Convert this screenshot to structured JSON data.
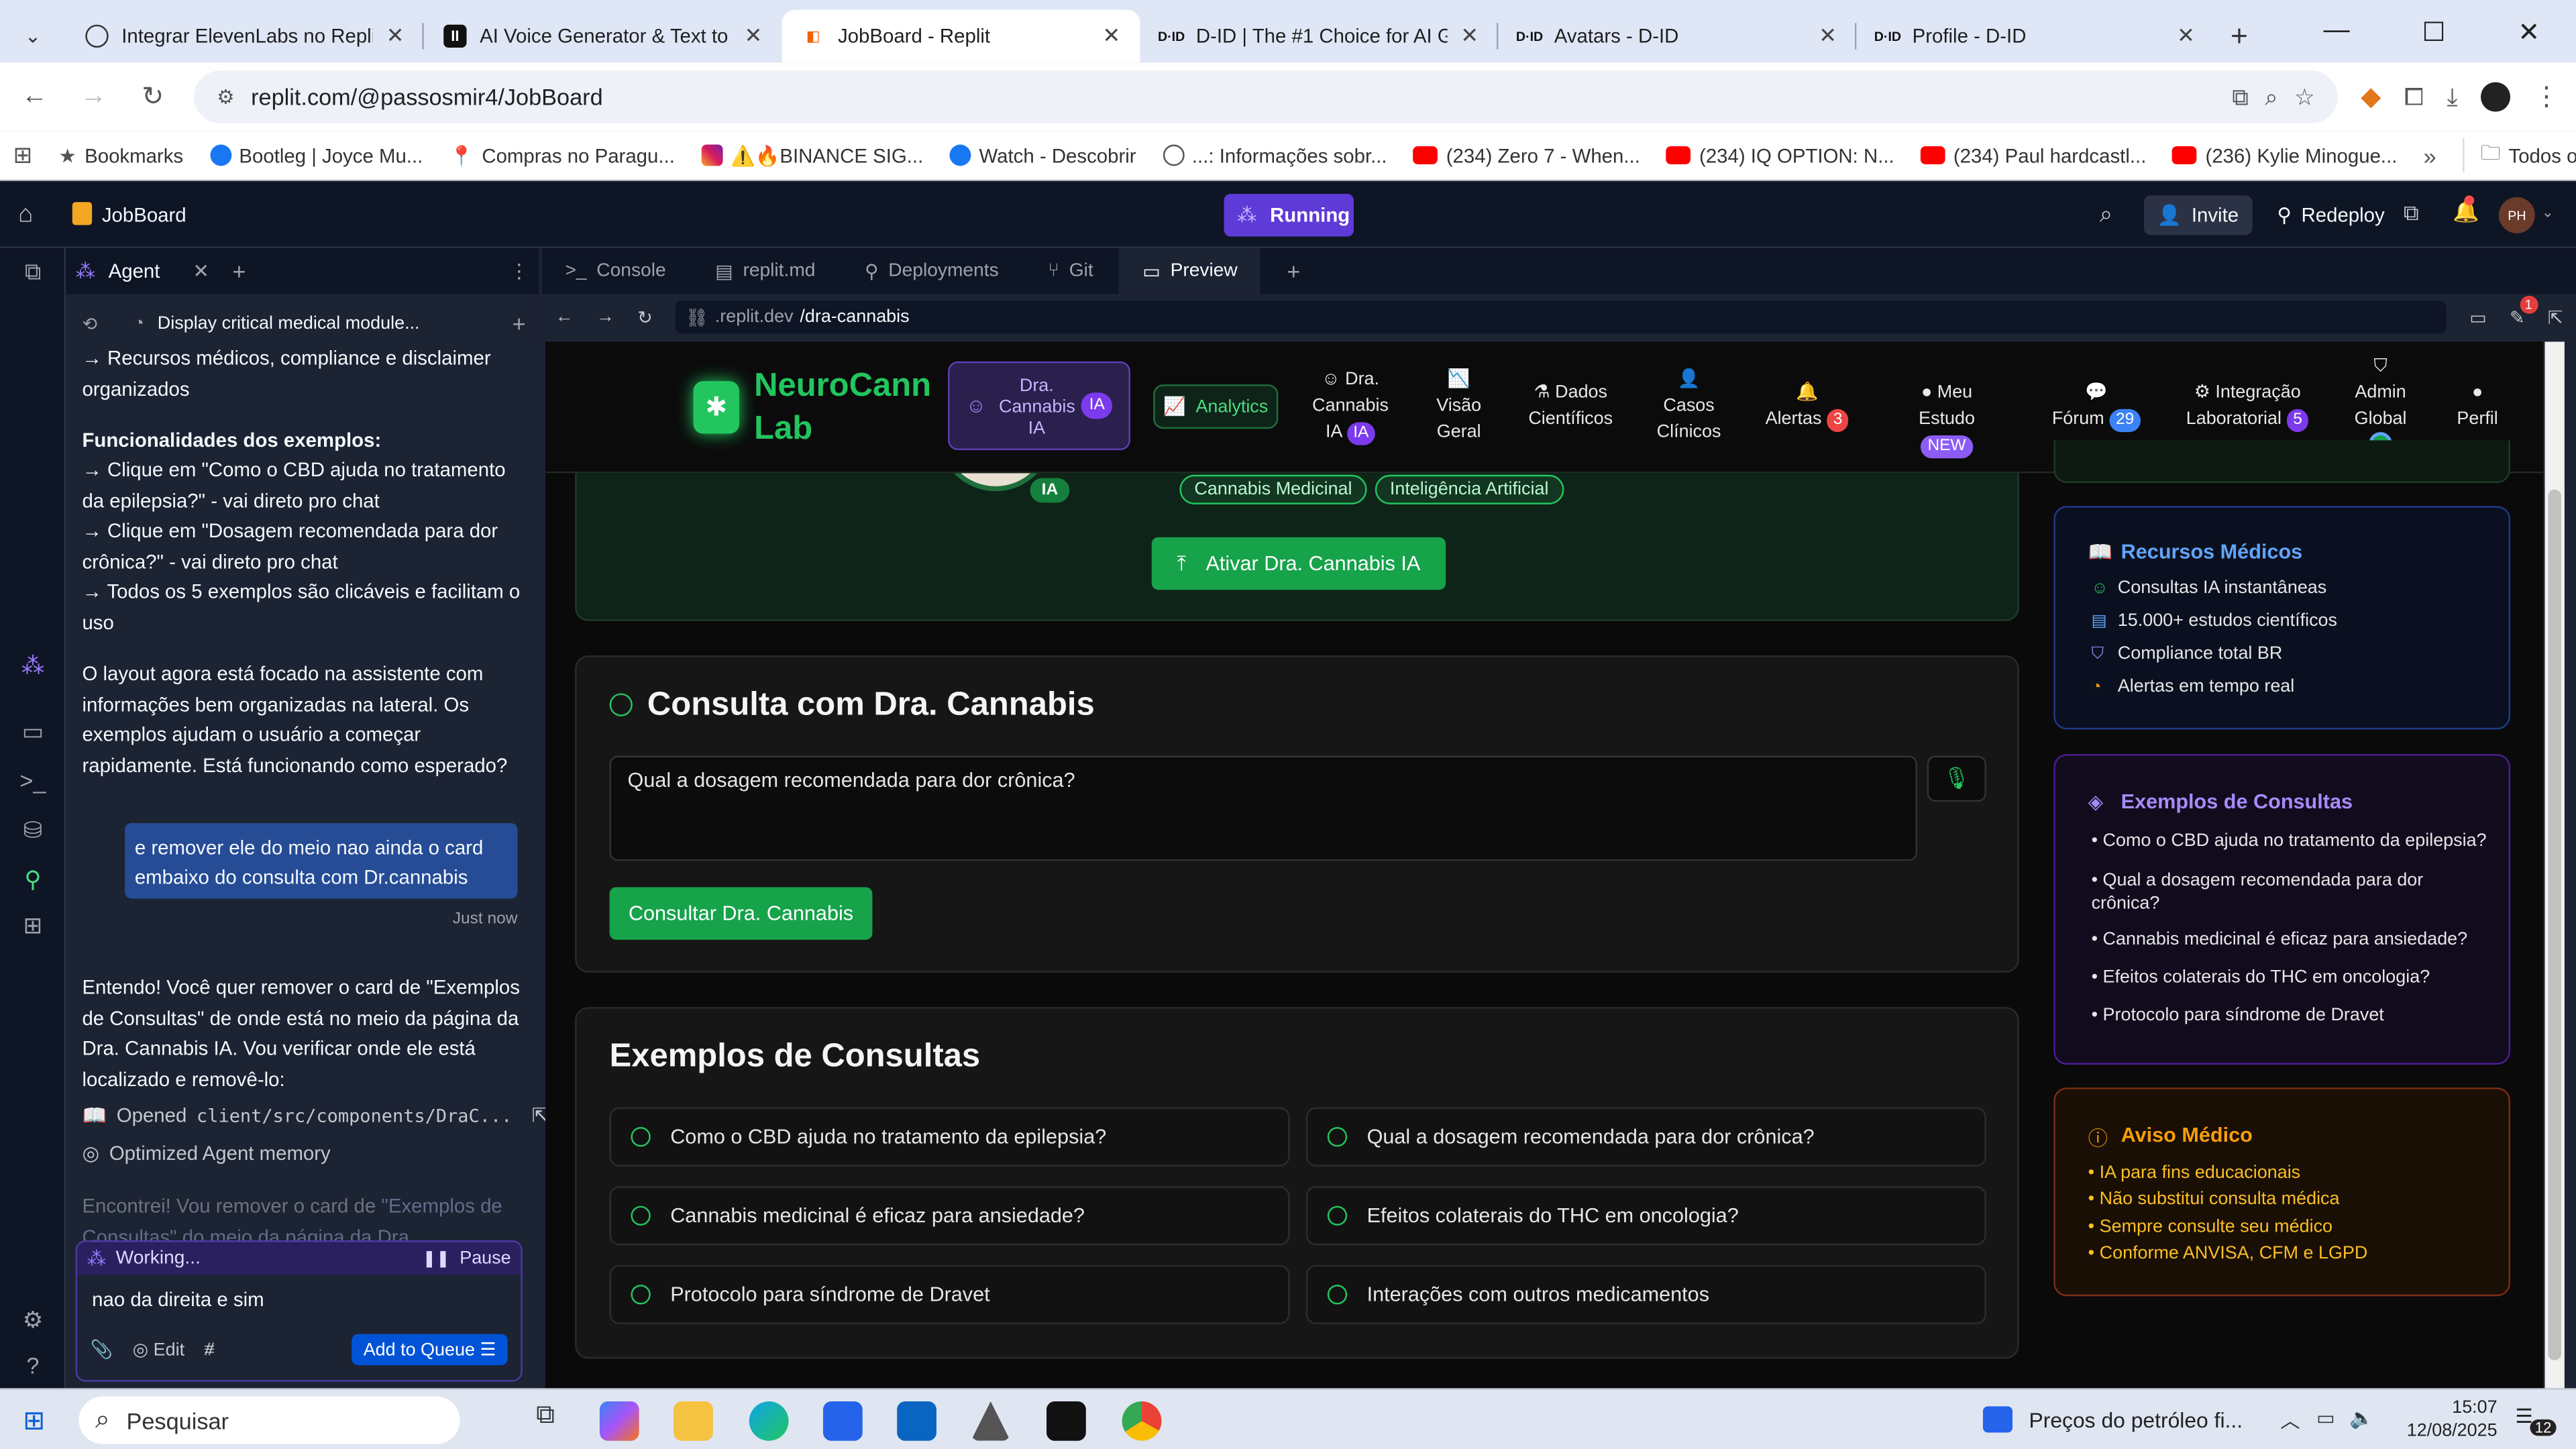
{
  "browser": {
    "tabs": [
      {
        "title": "Integrar ElevenLabs no Replit",
        "icon": "openai-icon",
        "active": false
      },
      {
        "title": "AI Voice Generator & Text to Sp",
        "icon": "elevenlabs-icon",
        "active": false
      },
      {
        "title": "JobBoard - Replit",
        "icon": "replit-icon",
        "active": true
      },
      {
        "title": "D-ID | The #1 Choice for AI Ger",
        "icon": "d-id-icon",
        "active": false
      },
      {
        "title": "Avatars - D-ID",
        "icon": "d-id-icon",
        "active": false
      },
      {
        "title": "Profile - D-ID",
        "icon": "d-id-icon",
        "active": false
      }
    ],
    "url": "replit.com/@passosmir4/JobBoard",
    "bookmarks": [
      {
        "label": "Bookmarks",
        "icon": "star-icon"
      },
      {
        "label": "Bootleg | Joyce Mu...",
        "icon": "facebook-icon"
      },
      {
        "label": "Compras no Paragu...",
        "icon": "pin-icon"
      },
      {
        "label": "⚠️🔥BINANCE SIG...",
        "icon": "instagram-icon"
      },
      {
        "label": "Watch - Descobrir",
        "icon": "facebook-icon"
      },
      {
        "label": "...: Informações sobr...",
        "icon": "globe-icon"
      },
      {
        "label": "(234) Zero 7 - When...",
        "icon": "youtube-icon"
      },
      {
        "label": "(234) IQ OPTION: N...",
        "icon": "youtube-icon"
      },
      {
        "label": "(234) Paul hardcastl...",
        "icon": "youtube-icon"
      },
      {
        "label": "(236) Kylie Minogue...",
        "icon": "youtube-icon"
      }
    ],
    "all_favorites": "Todos os favoritos"
  },
  "replit": {
    "project": "JobBoard",
    "status": "Running",
    "invite": "Invite",
    "redeploy": "Redeploy",
    "avatar": "PH",
    "notif_count": "1",
    "agent_tab": "Agent",
    "checkpoint": "Display critical medical module...",
    "chat": {
      "p1": "→ Recursos médicos, compliance e disclaimer organizados",
      "h2": "Funcionalidades dos exemplos:",
      "p2": "→ Clique em \"Como o CBD ajuda no tratamento da epilepsia?\" - vai direto pro chat",
      "p3": "→ Clique em \"Dosagem recomendada para dor crônica?\" - vai direto pro chat",
      "p4": "→ Todos os 5 exemplos são clicáveis e facilitam o uso",
      "p5": "O layout agora está focado na assistente com informações bem organizadas na lateral. Os exemplos ajudam o usuário a começar rapidamente. Está funcionando como esperado?",
      "user_msg": "e remover ele do meio nao ainda o card embaixo do consulta com Dr.cannabis",
      "user_time": "Just now",
      "p6": "Entendo! Você quer remover o card de \"Exemplos de Consultas\" de onde está no meio da página da Dra. Cannabis IA. Vou verificar onde ele está localizado e removê-lo:",
      "opened_prefix": "Opened ",
      "opened_file": "client/src/components/DraC...",
      "memory": "Optimized Agent memory",
      "p7a": "Encontrei! Vou remover o card de ",
      "p7b": "\"Exemplos de Consultas\" do meio da página da Dra."
    },
    "working": "Working...",
    "pause": "Pause",
    "input_text": "nao da direita e sim",
    "edit": "Edit",
    "add_queue": "Add to Queue",
    "ws_tabs": [
      "Console",
      "replit.md",
      "Deployments",
      "Git",
      "Preview"
    ],
    "preview_url_prefix": ".replit.dev",
    "preview_url_path": "/dra-cannabis",
    "preview_badge": "1"
  },
  "app": {
    "brand_line1": "NeuroCann",
    "brand_line2": "Lab",
    "nav": {
      "dra_active": [
        "Dra.",
        "Cannabis",
        "IA"
      ],
      "ia_badge": "IA",
      "analytics": "Analytics",
      "dra2": [
        "Dra.",
        "Cannabis"
      ],
      "dra2_last": "IA",
      "visao": [
        "Visão",
        "Geral"
      ],
      "dados": [
        "Dados",
        "Científicos"
      ],
      "casos": [
        "Casos",
        "Clínicos"
      ],
      "alertas": "Alertas",
      "alertas_count": "3",
      "meu": "Meu",
      "estudo": "Estudo",
      "new_badge": "NEW",
      "forum": "Fórum",
      "forum_count": "29",
      "integ1": "Integração",
      "integ2": "Laboratorial",
      "integ_count": "5",
      "admin": [
        "Admin",
        "Global"
      ],
      "perfil": "Perfil"
    },
    "hero": {
      "tag1": "Cannabis Medicinal",
      "tag2": "Inteligência Artificial",
      "avatar_badge": "IA",
      "activate": "Ativar Dra. Cannabis IA"
    },
    "consulta": {
      "title": "Consulta com Dra. Cannabis",
      "textarea": "Qual a dosagem recomendada para dor crônica?",
      "button": "Consultar Dra. Cannabis"
    },
    "exemplos": {
      "title": "Exemplos de Consultas",
      "items": [
        "Como o CBD ajuda no tratamento da epilepsia?",
        "Qual a dosagem recomendada para dor crônica?",
        "Cannabis medicinal é eficaz para ansiedade?",
        "Efeitos colaterais do THC em oncologia?",
        "Protocolo para síndrome de Dravet",
        "Interações com outros medicamentos"
      ]
    },
    "recursos": {
      "title": "Recursos Médicos",
      "items": [
        "Consultas IA instantâneas",
        "15.000+ estudos científicos",
        "Compliance total BR",
        "Alertas em tempo real"
      ]
    },
    "side_exemplos": {
      "title": "Exemplos de Consultas",
      "items": [
        "Como o CBD ajuda no tratamento da epilepsia?",
        "Qual a dosagem recomendada para dor crônica?",
        "Cannabis medicinal é eficaz para ansiedade?",
        "Efeitos colaterais do THC em oncologia?",
        "Protocolo para síndrome de Dravet"
      ]
    },
    "aviso": {
      "title": "Aviso Médico",
      "items": [
        "IA para fins educacionais",
        "Não substitui consulta médica",
        "Sempre consulte seu médico",
        "Conforme ANVISA, CFM e LGPD"
      ]
    }
  },
  "taskbar": {
    "search": "Pesquisar",
    "news": "Preços do petróleo fi...",
    "time": "15:07",
    "date": "12/08/2025",
    "notif": "12"
  },
  "colors": {
    "green": "#22c55e",
    "purple": "#8b5cf6",
    "orange": "#f59e0b",
    "replit_blue": "#0053d6"
  }
}
